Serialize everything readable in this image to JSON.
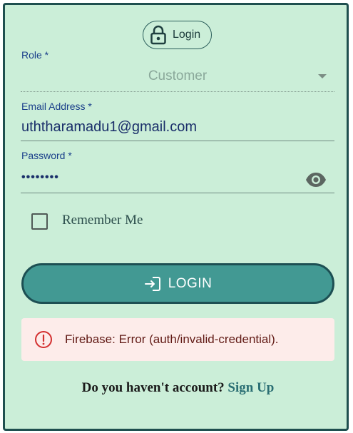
{
  "header": {
    "badge_label": "Login"
  },
  "role": {
    "label": "Role *",
    "value": "Customer"
  },
  "email": {
    "label": "Email Address *",
    "value": "uththaramadu1@gmail.com"
  },
  "password": {
    "label": "Password *",
    "value": "••••••••"
  },
  "remember": {
    "label": "Remember Me",
    "checked": false
  },
  "login_button": {
    "label": "LOGIN"
  },
  "alert": {
    "message": "Firebase: Error (auth/invalid-credential)."
  },
  "signup": {
    "prompt": "Do you haven't account?",
    "link": "Sign Up"
  },
  "colors": {
    "card_bg": "#cbeed8",
    "accent": "#429993",
    "error_bg": "#fdecea",
    "error_icon": "#d32f2f"
  }
}
